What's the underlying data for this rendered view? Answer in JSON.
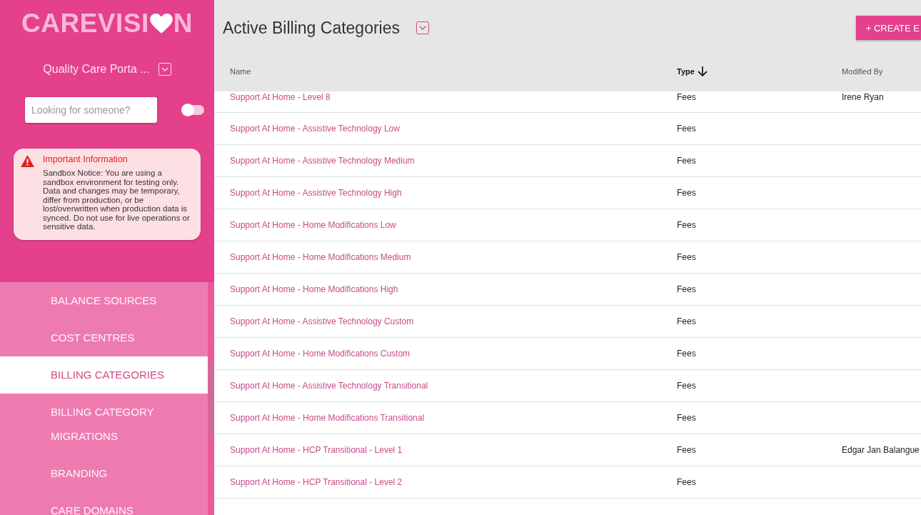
{
  "logo": {
    "text": "CAREVISI",
    "end": "N"
  },
  "portal": {
    "name": "Quality Care Porta ..."
  },
  "search": {
    "placeholder": "Looking for someone?",
    "toggle_on": false
  },
  "notice": {
    "title": "Important Information",
    "body": "Sandbox Notice: You are using a sandbox environment for testing only. Data and changes may be temporary, differ from production, or be lost/overwritten when production data is synced. Do not use for live operations or sensitive data."
  },
  "nav": [
    {
      "label": "BALANCE SOURCES",
      "selected": false
    },
    {
      "label": "COST CENTRES",
      "selected": false
    },
    {
      "label": "BILLING CATEGORIES",
      "selected": true
    },
    {
      "label": "BILLING CATEGORY MIGRATIONS",
      "selected": false
    },
    {
      "label": "BRANDING",
      "selected": false
    },
    {
      "label": "CARE DOMAINS",
      "selected": false
    }
  ],
  "page": {
    "title": "Active Billing Categories",
    "create_button": "+ CREATE E"
  },
  "table": {
    "columns": [
      {
        "label": "Name",
        "sorted": false
      },
      {
        "label": "Type",
        "sorted": true
      },
      {
        "label": "Modified By",
        "sorted": false
      }
    ],
    "rows": [
      [
        "Support At Home - Level 8",
        "Fees",
        "Irene Ryan"
      ],
      [
        "Support At Home - Assistive Technology Low",
        "Fees",
        ""
      ],
      [
        "Support At Home - Assistive Technology Medium",
        "Fees",
        ""
      ],
      [
        "Support At Home - Assistive Technology High",
        "Fees",
        ""
      ],
      [
        "Support At Home - Home Modifications Low",
        "Fees",
        ""
      ],
      [
        "Support At Home - Home Modifications Medium",
        "Fees",
        ""
      ],
      [
        "Support At Home - Home Modifications High",
        "Fees",
        ""
      ],
      [
        "Support At Home - Assistive Technology Custom",
        "Fees",
        ""
      ],
      [
        "Support At Home - Home Modifications Custom",
        "Fees",
        ""
      ],
      [
        "Support At Home - Assistive Technology Transitional",
        "Fees",
        ""
      ],
      [
        "Support At Home - Home Modifications Transitional",
        "Fees",
        ""
      ],
      [
        "Support At Home - HCP Transitional - Level 1",
        "Fees",
        "Edgar Jan Balangue"
      ],
      [
        "Support At Home - HCP Transitional - Level 2",
        "Fees",
        ""
      ]
    ]
  }
}
